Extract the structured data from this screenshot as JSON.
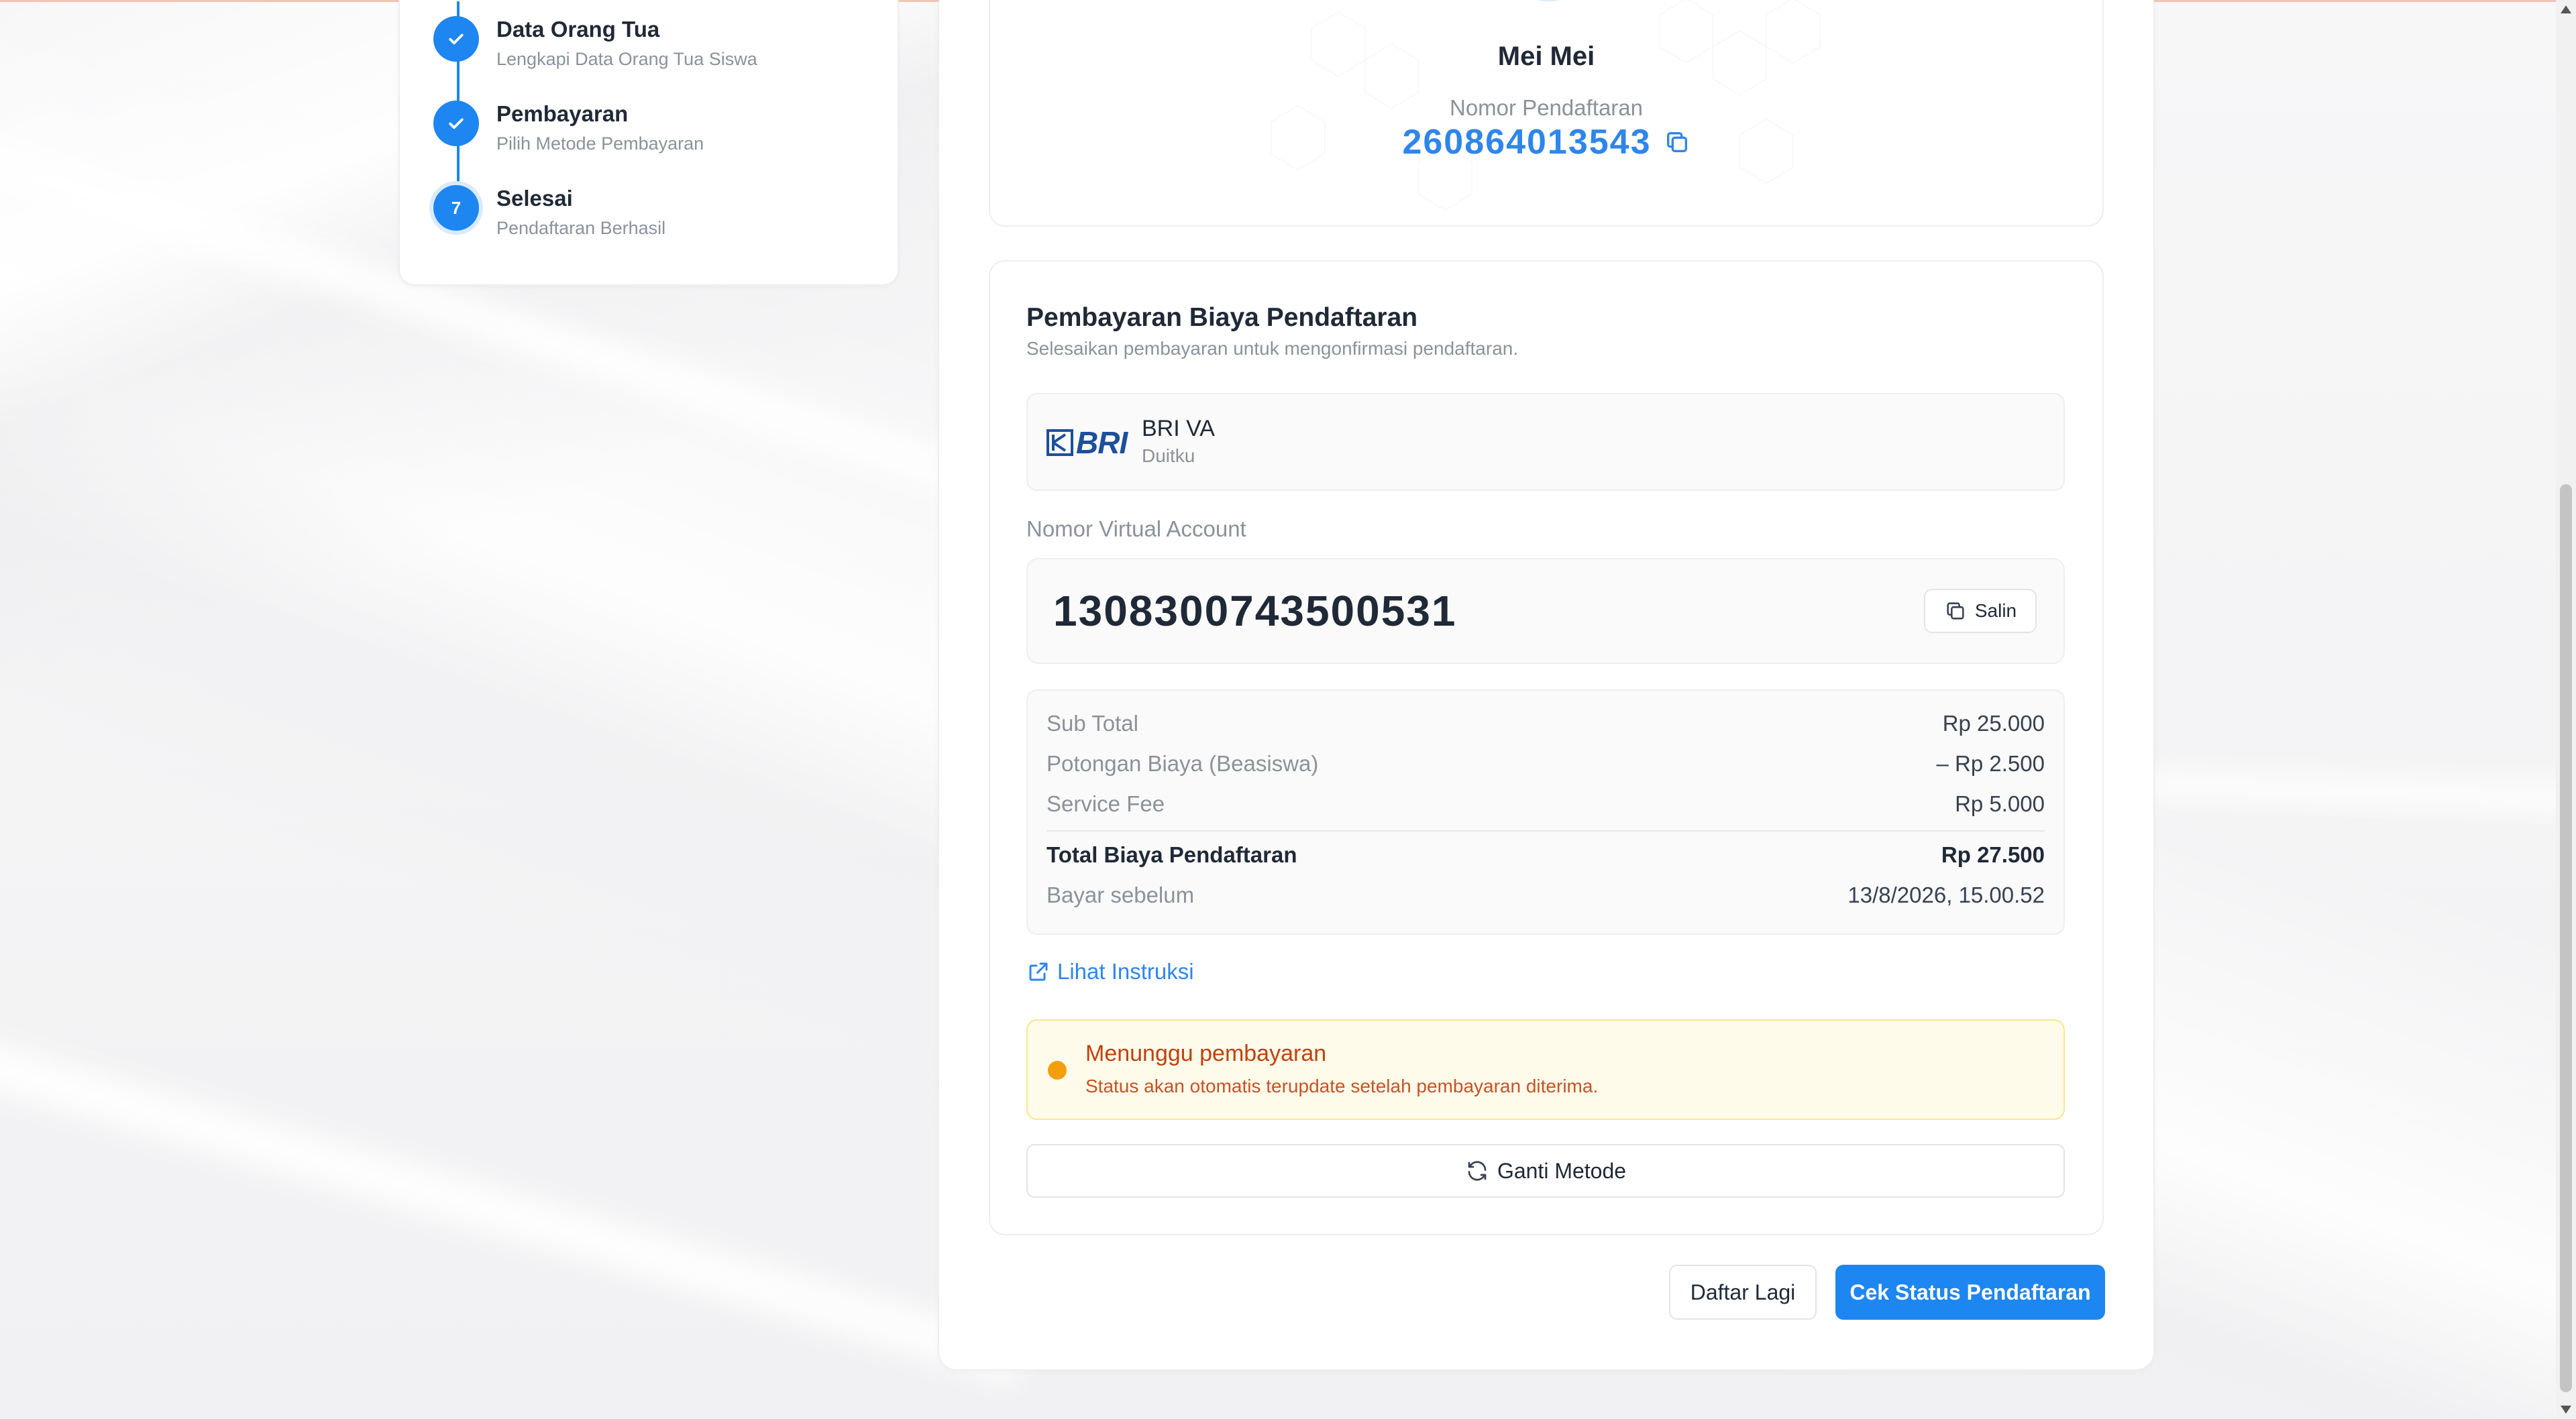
{
  "stepper": {
    "steps": [
      {
        "title": "Data Orang Tua",
        "subtitle": "Lengkapi Data Orang Tua Siswa",
        "state": "done",
        "icon": "check-icon"
      },
      {
        "title": "Pembayaran",
        "subtitle": "Pilih Metode Pembayaran",
        "state": "done",
        "icon": "check-icon"
      },
      {
        "title": "Selesai",
        "subtitle": "Pendaftaran Berhasil",
        "state": "current",
        "number": "7"
      }
    ]
  },
  "registration": {
    "student_name": "Mei Mei",
    "number_label": "Nomor Pendaftaran",
    "number": "260864013543",
    "copy_icon": "copy-icon"
  },
  "payment": {
    "title": "Pembayaran Biaya Pendaftaran",
    "subtitle": "Selesaikan pembayaran untuk mengonfirmasi pendaftaran.",
    "method": {
      "logo_text": "BRI",
      "name": "BRI VA",
      "provider": "Duitku"
    },
    "va_label": "Nomor Virtual Account",
    "va_number": "1308300743500531",
    "copy_label": "Salin",
    "summary": {
      "subtotal_label": "Sub Total",
      "subtotal_value": "Rp 25.000",
      "discount_label": "Potongan Biaya (Beasiswa)",
      "discount_value": "– Rp 2.500",
      "fee_label": "Service Fee",
      "fee_value": "Rp 5.000",
      "total_label": "Total Biaya Pendaftaran",
      "total_value": "Rp 27.500",
      "due_label": "Bayar sebelum",
      "due_value": "13/8/2026, 15.00.52"
    },
    "instructions_link": "Lihat Instruksi",
    "status": {
      "title": "Menunggu pembayaran",
      "subtitle": "Status akan otomatis terupdate setelah pembayaran diterima."
    },
    "change_method_label": "Ganti Metode"
  },
  "actions": {
    "register_again": "Daftar Lagi",
    "check_status": "Cek Status Pendaftaran"
  },
  "colors": {
    "primary": "#1d86f0",
    "link": "#2f86ea",
    "warning_bg": "#fffbeb",
    "warning_border": "#fde68a",
    "warning_text": "#c2410c",
    "warning_dot": "#f59e0b"
  }
}
